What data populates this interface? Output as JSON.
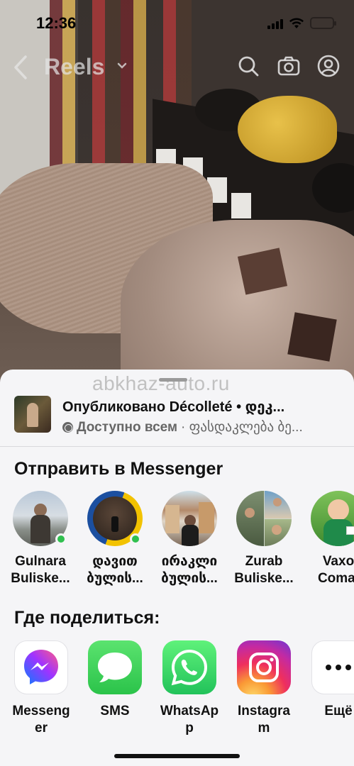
{
  "status_bar": {
    "time": "12:36"
  },
  "header": {
    "title": "Reels"
  },
  "watermark": "abkhaz-auto.ru",
  "post": {
    "title": "Опубликовано Décolleté • დეკ...",
    "audience": "Доступно всем",
    "subtitle_rest": " · ფასდაკლება ბე..."
  },
  "messenger_section": {
    "title": "Отправить в Messenger",
    "contacts": [
      {
        "line1": "Gulnara",
        "line2": "Buliske...",
        "online": true
      },
      {
        "line1": "დავით",
        "line2": "ბულის...",
        "online": true
      },
      {
        "line1": "ირაკლი",
        "line2": "ბულის...",
        "online": false
      },
      {
        "line1": "Zurab",
        "line2": "Buliske...",
        "online": false
      },
      {
        "line1": "Vaxo",
        "line2": "Comai",
        "online": false
      }
    ]
  },
  "share_section": {
    "title": "Где поделиться:",
    "apps": [
      {
        "line1": "Messeng",
        "line2": "er",
        "icon": "messenger-icon"
      },
      {
        "line1": "SMS",
        "line2": "",
        "icon": "sms-icon"
      },
      {
        "line1": "WhatsAp",
        "line2": "p",
        "icon": "whatsapp-icon"
      },
      {
        "line1": "Instagra",
        "line2": "m",
        "icon": "instagram-icon"
      },
      {
        "line1": "Ещё",
        "line2": "",
        "icon": "more-icon"
      }
    ]
  },
  "colors": {
    "sheet_bg": "#f5f5f7",
    "online": "#30c04f",
    "sms_green": "#34c759",
    "whatsapp_green": "#25d366"
  }
}
